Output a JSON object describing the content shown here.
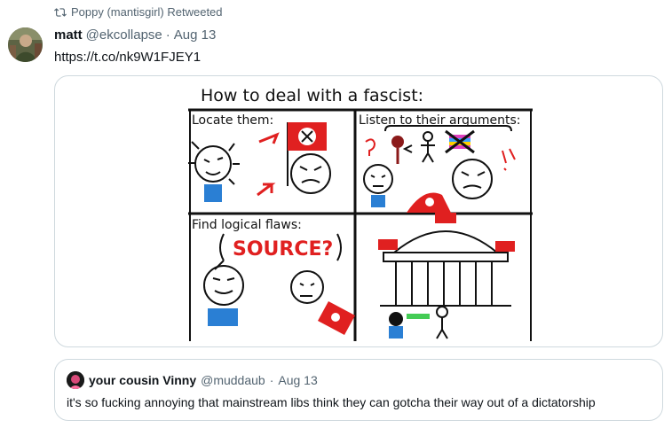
{
  "retweet": {
    "text": "Poppy (mantisgirl) Retweeted",
    "icon": "retweet-icon"
  },
  "tweet": {
    "author_name": "matt",
    "handle": "@ekcollapse",
    "separator": "·",
    "date": "Aug 13",
    "link_text": "https://t.co/nk9W1FJEY1"
  },
  "comic": {
    "title": "How to deal with a fascist:",
    "panels": [
      {
        "caption": "Locate them:"
      },
      {
        "caption": "Listen to their arguments:"
      },
      {
        "caption": "Find logical flaws:",
        "speech": "SOURCE?"
      },
      {
        "caption": ""
      }
    ]
  },
  "quote": {
    "author_name": "your cousin Vinny",
    "handle": "@muddaub",
    "separator": "·",
    "date": "Aug 13",
    "text": "it's so fucking annoying that mainstream libs think they can gotcha their way out of a dictatorship"
  },
  "colors": {
    "muted": "#536471",
    "border": "#cfd9de",
    "flag_red": "#e02020"
  }
}
